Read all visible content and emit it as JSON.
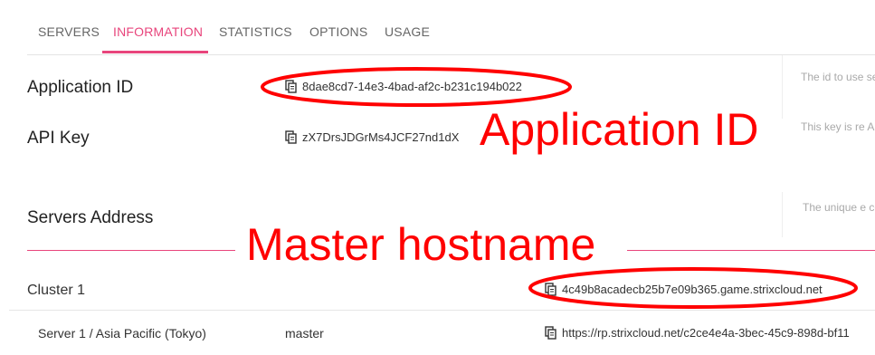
{
  "tabs": [
    {
      "label": "SERVERS"
    },
    {
      "label": "INFORMATION",
      "active": true
    },
    {
      "label": "STATISTICS"
    },
    {
      "label": "OPTIONS"
    },
    {
      "label": "USAGE"
    }
  ],
  "info": {
    "application_id": {
      "label": "Application ID",
      "value": "8dae8cd7-14e3-4bad-af2c-b231c194b022",
      "description": "The id to use servers."
    },
    "api_key": {
      "label": "API Key",
      "value": "zX7DrsJDGrMs4JCF27nd1dX",
      "description": "This key is re API."
    },
    "servers_address": {
      "label": "Servers Address",
      "description": "The unique e component."
    }
  },
  "cluster": {
    "label": "Cluster 1",
    "hostname": "4c49b8acadecb25b7e09b365.game.strixcloud.net"
  },
  "server": {
    "label": "Server 1 / Asia Pacific (Tokyo)",
    "role": "master",
    "url": "https://rp.strixcloud.net/c2ce4e4a-3bec-45c9-898d-bf11"
  },
  "annotations": {
    "application_id_callout": "Application ID",
    "master_hostname_callout": "Master hostname",
    "color": "#ff0000"
  },
  "colors": {
    "accent": "#e8457c",
    "annotation": "#ff0000"
  },
  "icons": {
    "copy": "copy-icon"
  }
}
